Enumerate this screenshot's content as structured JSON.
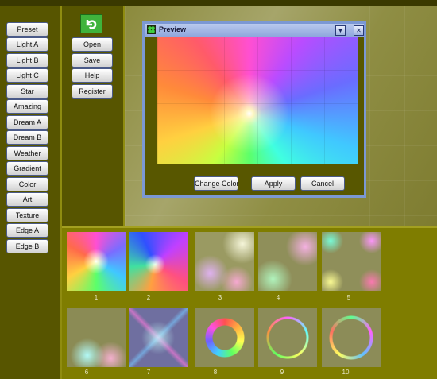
{
  "left_menu": [
    "Preset",
    "Light A",
    "Light B",
    "Light C",
    "Star",
    "Amazing",
    "Dream A",
    "Dream B",
    "Weather",
    "Gradient",
    "Color",
    "Art",
    "Texture",
    "Edge A",
    "Edge B"
  ],
  "file_menu": {
    "open": "Open",
    "save": "Save",
    "help": "Help",
    "register": "Register"
  },
  "preview_dialog": {
    "title": "Preview",
    "change_color": "Change Color",
    "apply": "Apply",
    "cancel": "Cancel"
  },
  "thumbnails": [
    "1",
    "2",
    "3",
    "4",
    "5",
    "6",
    "7",
    "8",
    "9",
    "10"
  ],
  "icons": {
    "undo": "undo-arrow-icon",
    "app": "clover-icon",
    "dropdown": "chevron-down-icon",
    "close": "close-icon"
  },
  "colors": {
    "panel": "#575500",
    "thumb_area": "#7f7d00",
    "titlebar": "#8ea6dc"
  }
}
